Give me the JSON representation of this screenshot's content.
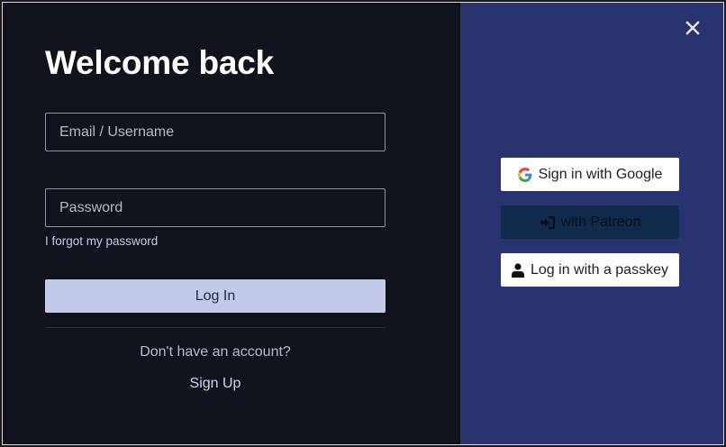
{
  "dialog": {
    "title": "Welcome back",
    "close_icon": "close-icon"
  },
  "form": {
    "email_placeholder": "Email / Username",
    "password_placeholder": "Password",
    "forgot_label": "I forgot my password",
    "login_label": "Log In",
    "no_account_text": "Don't have an account?",
    "signup_label": "Sign Up"
  },
  "social": {
    "google_label": "Sign in with Google",
    "google_icon": "google-icon",
    "patreon_label": "with Patreon",
    "patreon_icon": "sign-in-icon",
    "passkey_label": "Log in with a passkey",
    "passkey_icon": "user-icon"
  },
  "colors": {
    "left_panel_bg": "#11131c",
    "right_panel_bg": "#293370",
    "login_button_bg": "#c2cae9",
    "patreon_button_bg": "#0f2a4b"
  }
}
